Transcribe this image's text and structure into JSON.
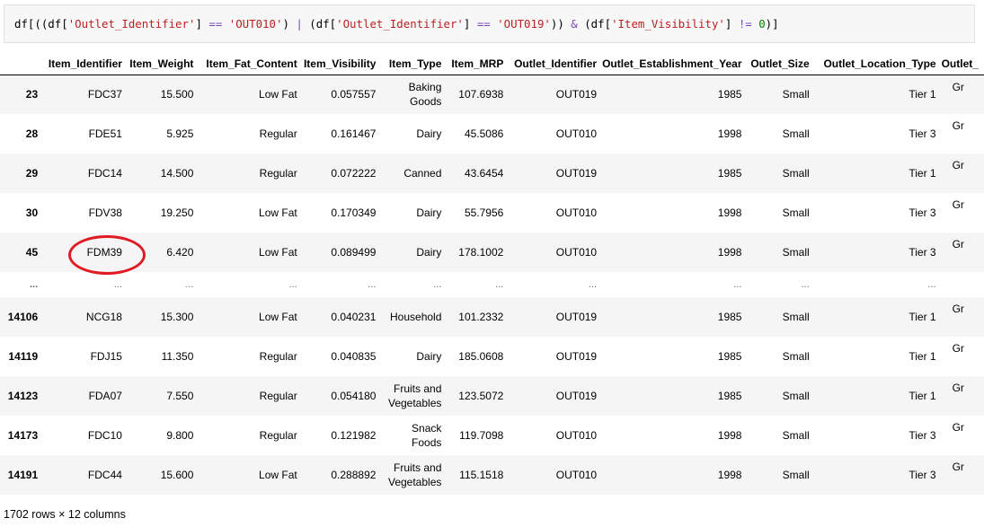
{
  "code": {
    "segments": [
      {
        "t": "df[((df[",
        "c": ""
      },
      {
        "t": "'Outlet_Identifier'",
        "c": "str"
      },
      {
        "t": "] ",
        "c": ""
      },
      {
        "t": "==",
        "c": "op"
      },
      {
        "t": " ",
        "c": ""
      },
      {
        "t": "'OUT010'",
        "c": "str"
      },
      {
        "t": ") ",
        "c": ""
      },
      {
        "t": "|",
        "c": "op"
      },
      {
        "t": " (df[",
        "c": ""
      },
      {
        "t": "'Outlet_Identifier'",
        "c": "str"
      },
      {
        "t": "] ",
        "c": ""
      },
      {
        "t": "==",
        "c": "op"
      },
      {
        "t": " ",
        "c": ""
      },
      {
        "t": "'OUT019'",
        "c": "str"
      },
      {
        "t": ")) ",
        "c": ""
      },
      {
        "t": "&",
        "c": "op"
      },
      {
        "t": " (df[",
        "c": ""
      },
      {
        "t": "'Item_Visibility'",
        "c": "str"
      },
      {
        "t": "] ",
        "c": ""
      },
      {
        "t": "!=",
        "c": "op"
      },
      {
        "t": " ",
        "c": ""
      },
      {
        "t": "0",
        "c": "num"
      },
      {
        "t": ")]",
        "c": ""
      }
    ]
  },
  "table": {
    "columns": [
      "",
      "Item_Identifier",
      "Item_Weight",
      "Item_Fat_Content",
      "Item_Visibility",
      "Item_Type",
      "Item_MRP",
      "Outlet_Identifier",
      "Outlet_Establishment_Year",
      "Outlet_Size",
      "Outlet_Location_Type",
      "Outlet_"
    ],
    "rows": [
      {
        "index": "23",
        "cells": [
          "FDC37",
          "15.500",
          "Low Fat",
          "0.057557",
          "Baking Goods",
          "107.6938",
          "OUT019",
          "1985",
          "Small",
          "Tier 1",
          "Gr"
        ]
      },
      {
        "index": "28",
        "cells": [
          "FDE51",
          "5.925",
          "Regular",
          "0.161467",
          "Dairy",
          "45.5086",
          "OUT010",
          "1998",
          "Small",
          "Tier 3",
          "Gr"
        ]
      },
      {
        "index": "29",
        "cells": [
          "FDC14",
          "14.500",
          "Regular",
          "0.072222",
          "Canned",
          "43.6454",
          "OUT019",
          "1985",
          "Small",
          "Tier 1",
          "Gr"
        ]
      },
      {
        "index": "30",
        "cells": [
          "FDV38",
          "19.250",
          "Low Fat",
          "0.170349",
          "Dairy",
          "55.7956",
          "OUT010",
          "1998",
          "Small",
          "Tier 3",
          "Gr"
        ]
      },
      {
        "index": "45",
        "cells": [
          "FDM39",
          "6.420",
          "Low Fat",
          "0.089499",
          "Dairy",
          "178.1002",
          "OUT010",
          "1998",
          "Small",
          "Tier 3",
          "Gr"
        ]
      },
      {
        "index": "...",
        "ellipsis": true,
        "cells": [
          "...",
          "...",
          "...",
          "...",
          "...",
          "...",
          "...",
          "...",
          "...",
          "...",
          ""
        ]
      },
      {
        "index": "14106",
        "cells": [
          "NCG18",
          "15.300",
          "Low Fat",
          "0.040231",
          "Household",
          "101.2332",
          "OUT019",
          "1985",
          "Small",
          "Tier 1",
          "Gr"
        ]
      },
      {
        "index": "14119",
        "cells": [
          "FDJ15",
          "11.350",
          "Regular",
          "0.040835",
          "Dairy",
          "185.0608",
          "OUT019",
          "1985",
          "Small",
          "Tier 1",
          "Gr"
        ]
      },
      {
        "index": "14123",
        "cells": [
          "FDA07",
          "7.550",
          "Regular",
          "0.054180",
          "Fruits and Vegetables",
          "123.5072",
          "OUT019",
          "1985",
          "Small",
          "Tier 1",
          "Gr"
        ]
      },
      {
        "index": "14173",
        "cells": [
          "FDC10",
          "9.800",
          "Regular",
          "0.121982",
          "Snack Foods",
          "119.7098",
          "OUT010",
          "1998",
          "Small",
          "Tier 3",
          "Gr"
        ]
      },
      {
        "index": "14191",
        "cells": [
          "FDC44",
          "15.600",
          "Low Fat",
          "0.288892",
          "Fruits and Vegetables",
          "115.1518",
          "OUT010",
          "1998",
          "Small",
          "Tier 3",
          "Gr"
        ]
      }
    ]
  },
  "footer": "1702 rows × 12 columns",
  "annotation": {
    "color": "#e01b24"
  }
}
